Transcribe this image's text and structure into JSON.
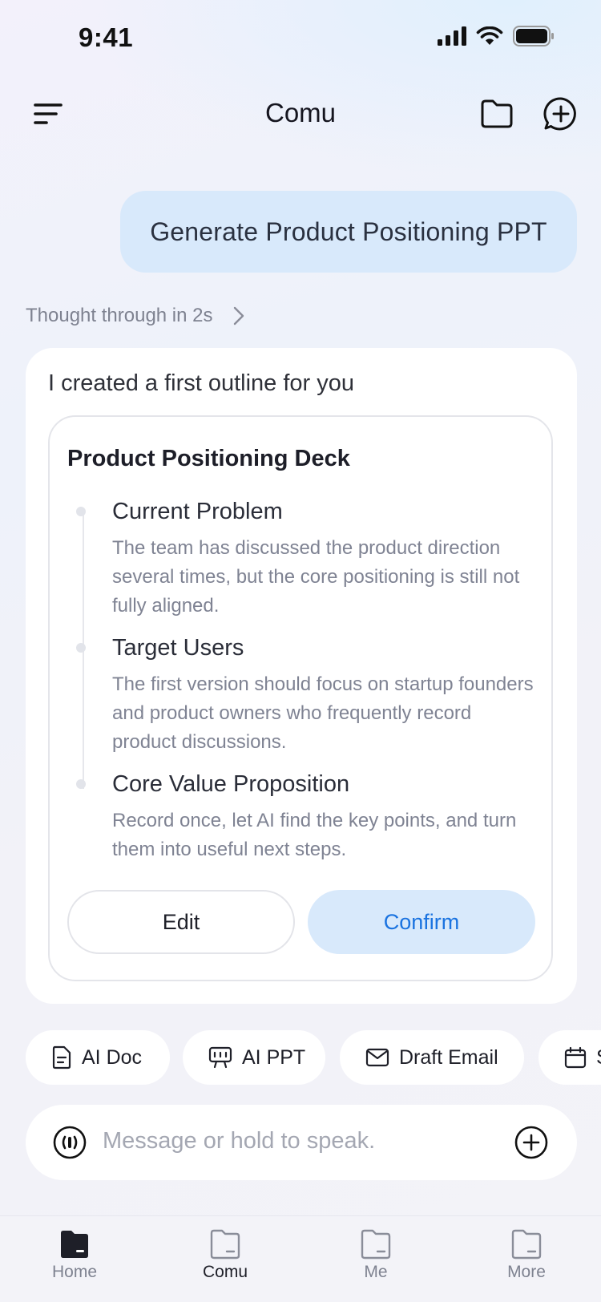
{
  "status_bar": {
    "time": "9:41",
    "icons": [
      "cellular-signal-icon",
      "wifi-icon",
      "battery-icon"
    ]
  },
  "header": {
    "title": "Comu",
    "icons": [
      "menu-icon",
      "folder-icon",
      "new-chat-icon"
    ]
  },
  "user_message": "Generate Product Positioning PPT",
  "thought": {
    "label": "Thought through in 2s",
    "icon": "chevron-right-icon"
  },
  "response": {
    "intro": "I created a first outline for you",
    "outline": {
      "title": "Product Positioning Deck",
      "items": [
        {
          "title": "Current Problem",
          "description": "The team has discussed the product direction several times, but the core positioning is still not fully aligned."
        },
        {
          "title": "Target Users",
          "description": "The first version should focus on startup founders and product owners who frequently record product discussions."
        },
        {
          "title": "Core Value Proposition",
          "description": "Record once, let AI find the key points, and turn them into useful next steps."
        }
      ],
      "edit_label": "Edit",
      "confirm_label": "Confirm"
    }
  },
  "chips": [
    {
      "label": "AI Doc",
      "icon": "document-icon"
    },
    {
      "label": "AI PPT",
      "icon": "presentation-icon"
    },
    {
      "label": "Draft Email",
      "icon": "mail-icon"
    },
    {
      "label": "S",
      "icon": "calendar-icon"
    }
  ],
  "input": {
    "placeholder": "Message or hold to speak.",
    "icons": [
      "voice-icon",
      "plus-icon"
    ]
  },
  "tabs": [
    {
      "label": "Home",
      "active": false
    },
    {
      "label": "Comu",
      "active": true
    },
    {
      "label": "Me",
      "active": false
    },
    {
      "label": "More",
      "active": false
    }
  ],
  "colors": {
    "accent": "#1a73e0",
    "bubble": "#d8e9fb",
    "muted": "#7f8393"
  }
}
